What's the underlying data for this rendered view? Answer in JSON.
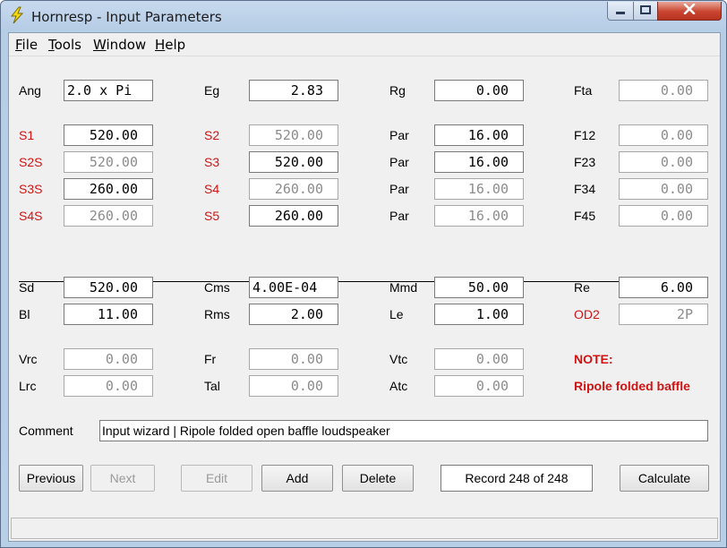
{
  "window": {
    "title": "Hornresp - Input Parameters",
    "accent_close": "#c9452f"
  },
  "menu": [
    "File",
    "Tools",
    "Window",
    "Help"
  ],
  "labels": {
    "ang": "Ang",
    "eg": "Eg",
    "rg": "Rg",
    "fta": "Fta",
    "s1": "S1",
    "s2": "S2",
    "par1": "Par",
    "f12": "F12",
    "s2s": "S2S",
    "s3": "S3",
    "par2": "Par",
    "f23": "F23",
    "s3s": "S3S",
    "s4": "S4",
    "par3": "Par",
    "f34": "F34",
    "s4s": "S4S",
    "s5": "S5",
    "par4": "Par",
    "f45": "F45",
    "sd": "Sd",
    "cms": "Cms",
    "mmd": "Mmd",
    "re": "Re",
    "bl": "Bl",
    "rms": "Rms",
    "le": "Le",
    "od2": "OD2",
    "vrc": "Vrc",
    "fr": "Fr",
    "vtc": "Vtc",
    "note": "NOTE:",
    "lrc": "Lrc",
    "tal": "Tal",
    "atc": "Atc",
    "note_text": "Ripole folded baffle",
    "comment": "Comment"
  },
  "values": {
    "ang": "2.0 x Pi",
    "eg": "2.83",
    "rg": "0.00",
    "fta": "0.00",
    "s1": "520.00",
    "s2": "520.00",
    "par1": "16.00",
    "f12": "0.00",
    "s2s": "520.00",
    "s3": "520.00",
    "par2": "16.00",
    "f23": "0.00",
    "s3s": "260.00",
    "s4": "260.00",
    "par3": "16.00",
    "f34": "0.00",
    "s4s": "260.00",
    "s5": "260.00",
    "par4": "16.00",
    "f45": "0.00",
    "sd": "520.00",
    "cms": "4.00E-04",
    "mmd": "50.00",
    "re": "6.00",
    "bl": "11.00",
    "rms": "2.00",
    "le": "1.00",
    "od2": "2P",
    "vrc": "0.00",
    "fr": "0.00",
    "vtc": "0.00",
    "lrc": "0.00",
    "tal": "0.00",
    "atc": "0.00"
  },
  "comment": "Input wizard | Ripole folded open baffle loudspeaker",
  "buttons": {
    "previous": "Previous",
    "next": "Next",
    "edit": "Edit",
    "add": "Add",
    "delete": "Delete",
    "calculate": "Calculate"
  },
  "record": "Record 248 of 248",
  "colors": {
    "label_red": "#d01414",
    "disabled_text": "#8c8c8c"
  }
}
